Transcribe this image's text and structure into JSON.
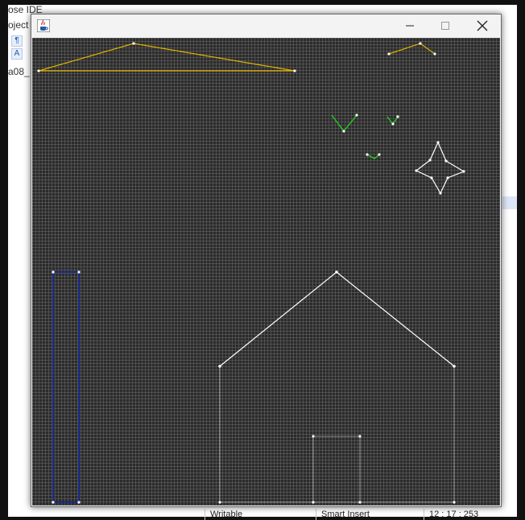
{
  "ide": {
    "title_fragment": "ose IDE",
    "menu_fragment": "oject",
    "file_tab_fragment": "a08_",
    "toolbar_glyphs": [
      "¶",
      "A"
    ],
    "status": {
      "writable": "Writable",
      "insert_mode": "Smart Insert",
      "position": "12 : 17 : 253"
    }
  },
  "window": {
    "minimize_label": "—",
    "maximize_label": "☐",
    "close_label": "✕",
    "icon": "java-cup-icon"
  },
  "drawing": {
    "background": "#2b2b2b",
    "grid_color": "#6e6e6e",
    "colors": {
      "yellow": "#e0b000",
      "white": "#ffffff",
      "green": "#22cc22",
      "blue": "#1a2a8a"
    },
    "shapes": [
      "yellow-triangle-outline",
      "yellow-small-peak",
      "green-check-large",
      "green-check-medium",
      "green-check-small",
      "white-four-point-star",
      "white-house-roof",
      "white-house-walls",
      "white-house-door",
      "blue-tall-rectangle"
    ]
  }
}
